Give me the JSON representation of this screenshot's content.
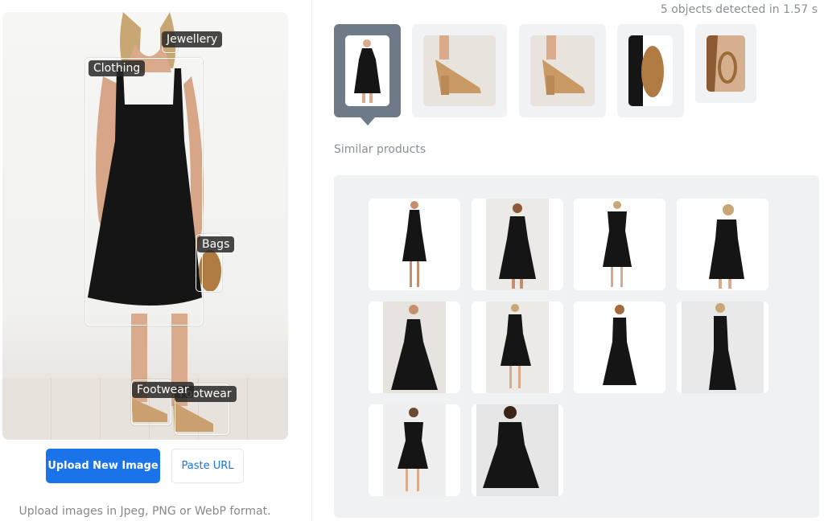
{
  "upload": {
    "button_label": "Upload New Image",
    "paste_label": "Paste URL",
    "hint": "Upload images in Jpeg, PNG or WebP format."
  },
  "detections": [
    {
      "label": "Jewellery"
    },
    {
      "label": "Clothing"
    },
    {
      "label": "Bags"
    },
    {
      "label": "Footwear"
    },
    {
      "label": "Footwear"
    }
  ],
  "status": "5 objects detected in 1.57 s",
  "thumbnails": [
    {
      "category": "dress",
      "selected": true
    },
    {
      "category": "shoe",
      "selected": false
    },
    {
      "category": "shoe",
      "selected": false
    },
    {
      "category": "bag",
      "selected": false
    },
    {
      "category": "earring",
      "selected": false
    }
  ],
  "similar": {
    "title": "Similar products",
    "count": 10
  },
  "colors": {
    "accent": "#1a73e8",
    "selected_thumb": "#6f7a89",
    "panel_bg": "#f0f1f3"
  }
}
